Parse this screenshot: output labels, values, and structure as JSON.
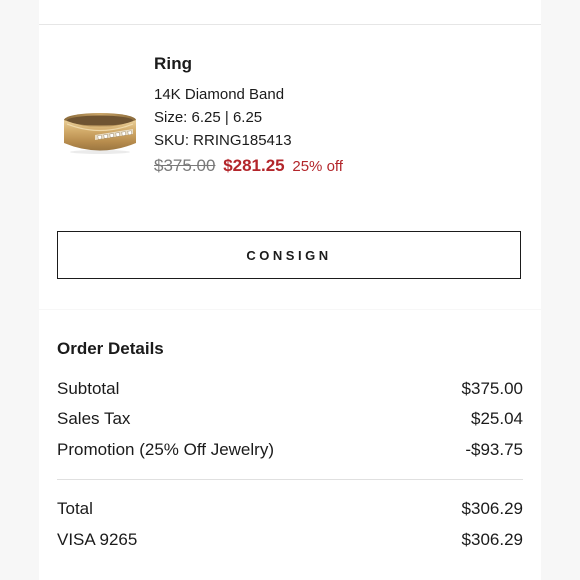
{
  "product": {
    "name": "Ring",
    "description": "14K Diamond Band",
    "size": "Size: 6.25 | 6.25",
    "sku": "SKU: RRING185413",
    "original_price": "$375.00",
    "sale_price": "$281.25",
    "discount": "25% off",
    "image_icon": "gold-ring-image"
  },
  "actions": {
    "consign_label": "CONSIGN"
  },
  "order_details": {
    "title": "Order Details",
    "subtotal_label": "Subtotal",
    "subtotal_value": "$375.00",
    "tax_label": "Sales Tax",
    "tax_value": "$25.04",
    "promo_label": "Promotion (25% Off Jewelry)",
    "promo_value": "-$93.75",
    "total_label": "Total",
    "total_value": "$306.29",
    "payment_label": "VISA 9265",
    "payment_value": "$306.29"
  },
  "colors": {
    "sale_red": "#b3262b",
    "strike_gray": "#7a7a7a",
    "text": "#1b1b1b",
    "background": "#f7f7f7"
  }
}
